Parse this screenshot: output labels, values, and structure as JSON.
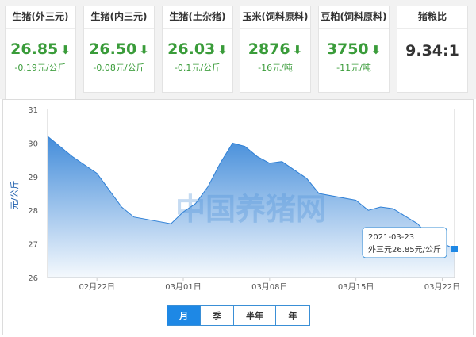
{
  "cards": [
    {
      "name": "生猪(外三元)",
      "price": "26.85",
      "change": "-0.19元/公斤"
    },
    {
      "name": "生猪(内三元)",
      "price": "26.50",
      "change": "-0.08元/公斤"
    },
    {
      "name": "生猪(土杂猪)",
      "price": "26.03",
      "change": "-0.1元/公斤"
    },
    {
      "name": "玉米(饲料原料)",
      "price": "2876",
      "change": "-16元/吨"
    },
    {
      "name": "豆粕(饲料原料)",
      "price": "3750",
      "change": "-11元/吨"
    },
    {
      "name": "猪粮比",
      "price": "9.34:1"
    }
  ],
  "icons": {
    "down_arrow": "down-arrow-icon"
  },
  "colors": {
    "down": "#3a9c3a",
    "accent": "#1e88e5",
    "area": "#2f80d6"
  },
  "watermark": "中国养猪网",
  "tooltip": {
    "date": "2021-03-23",
    "value_text": "外三元26.85元/公斤"
  },
  "chart_data": {
    "type": "area",
    "title": "",
    "ylabel": "元/公斤",
    "xlabel": "",
    "ylim": [
      26,
      31
    ],
    "yticks": [
      "26",
      "27",
      "28",
      "29",
      "30",
      "31"
    ],
    "xticks": [
      "02月22日",
      "03月01日",
      "03月08日",
      "03月15日",
      "03月22日"
    ],
    "x": [
      "2021-02-18",
      "2021-02-20",
      "2021-02-22",
      "2021-02-24",
      "2021-02-25",
      "2021-02-28",
      "2021-03-01",
      "2021-03-02",
      "2021-03-03",
      "2021-03-04",
      "2021-03-05",
      "2021-03-06",
      "2021-03-07",
      "2021-03-08",
      "2021-03-09",
      "2021-03-10",
      "2021-03-11",
      "2021-03-12",
      "2021-03-15",
      "2021-03-16",
      "2021-03-17",
      "2021-03-18",
      "2021-03-20",
      "2021-03-21",
      "2021-03-23"
    ],
    "values": [
      30.2,
      29.6,
      29.1,
      28.1,
      27.8,
      27.6,
      27.95,
      28.2,
      28.7,
      29.4,
      30.0,
      29.9,
      29.6,
      29.4,
      29.45,
      29.2,
      28.95,
      28.5,
      28.3,
      28.0,
      28.1,
      28.05,
      27.6,
      27.2,
      26.85
    ],
    "grid": false,
    "legend": "none"
  },
  "periods": [
    "月",
    "季",
    "半年",
    "年"
  ],
  "active_period": "月"
}
